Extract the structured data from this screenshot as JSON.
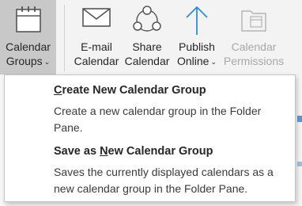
{
  "ribbon": {
    "buttons": [
      {
        "key": "calendar_groups",
        "label_line1": "Calendar",
        "label_line2": "Groups",
        "has_dropdown": true,
        "selected": true,
        "disabled": false,
        "icon": "calendar-icon"
      },
      {
        "key": "email_calendar",
        "label_line1": "E-mail",
        "label_line2": "Calendar",
        "has_dropdown": false,
        "selected": false,
        "disabled": false,
        "icon": "envelope-icon"
      },
      {
        "key": "share_calendar",
        "label_line1": "Share",
        "label_line2": "Calendar",
        "has_dropdown": false,
        "selected": false,
        "disabled": false,
        "icon": "share-nodes-icon"
      },
      {
        "key": "publish_online",
        "label_line1": "Publish",
        "label_line2": "Online",
        "has_dropdown": true,
        "selected": false,
        "disabled": false,
        "icon": "arrow-up-icon"
      },
      {
        "key": "calendar_permissions",
        "label_line1": "Calendar",
        "label_line2": "Permissions",
        "has_dropdown": false,
        "selected": false,
        "disabled": true,
        "icon": "calendar-folder-icon"
      }
    ]
  },
  "menu": {
    "items": [
      {
        "title": "Create New Calendar Group",
        "mnemonic_index": 0,
        "description": "Create a new calendar group in the Folder Pane."
      },
      {
        "title": "Save as New Calendar Group",
        "mnemonic_index": 8,
        "description": "Saves the currently displayed calendars as a new calendar group in the Folder Pane."
      }
    ]
  },
  "colors": {
    "ribbon_bg": "#f3f3f3",
    "selected_bg": "#c8c8c8",
    "disabled_text": "#a8a8a8",
    "accent_blue": "#2e8fd8"
  },
  "caret_glyph": "⌄"
}
